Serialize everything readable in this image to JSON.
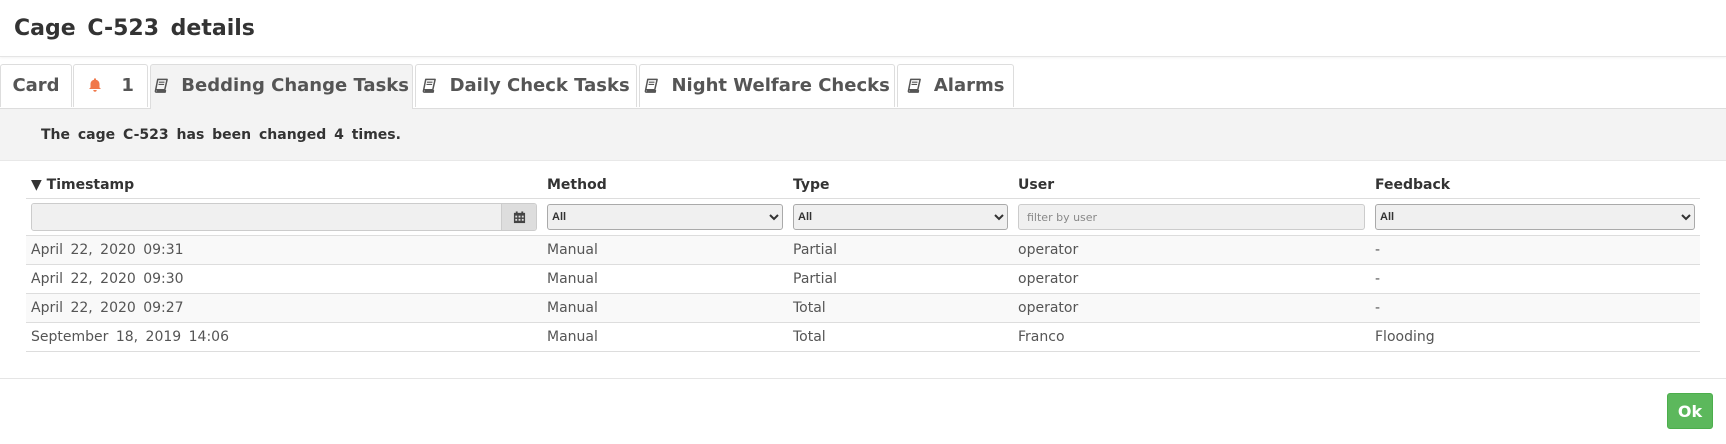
{
  "dialog": {
    "title": "Cage  C-523  details"
  },
  "tabs": {
    "card": "Card",
    "alarm_count": "1",
    "bedding": "Bedding Change Tasks",
    "daily": "Daily Check Tasks",
    "night": "Night Welfare Checks",
    "alarms": "Alarms"
  },
  "colors": {
    "bell": "#f0784a",
    "ok_button": "#5cb85c"
  },
  "info": {
    "message": "The cage C-523 has been changed 4 times."
  },
  "table": {
    "sort_indicator": "▼",
    "headers": {
      "timestamp": "Timestamp",
      "method": "Method",
      "type": "Type",
      "user": "User",
      "feedback": "Feedback"
    },
    "filters": {
      "method": "All",
      "type": "All",
      "user_placeholder": "filter by user",
      "feedback": "All"
    },
    "rows": [
      {
        "timestamp": "April 22, 2020 09:31",
        "method": "Manual",
        "type": "Partial",
        "user": "operator",
        "feedback": "-"
      },
      {
        "timestamp": "April 22, 2020 09:30",
        "method": "Manual",
        "type": "Partial",
        "user": "operator",
        "feedback": "-"
      },
      {
        "timestamp": "April 22, 2020 09:27",
        "method": "Manual",
        "type": "Total",
        "user": "operator",
        "feedback": "-"
      },
      {
        "timestamp": "September 18, 2019 14:06",
        "method": "Manual",
        "type": "Total",
        "user": "Franco",
        "feedback": "Flooding"
      }
    ]
  },
  "footer": {
    "ok_label": "Ok"
  }
}
